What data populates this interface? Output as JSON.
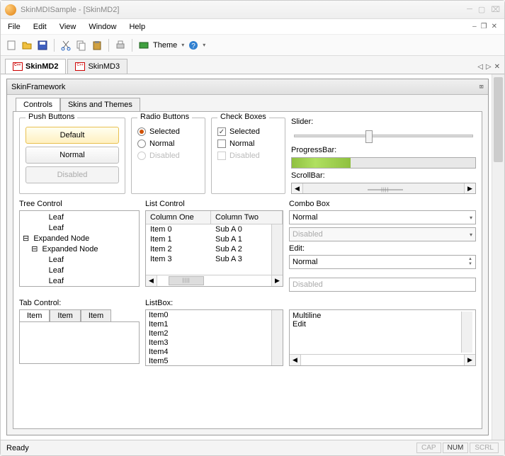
{
  "title": "SkinMDISample - [SkinMD2]",
  "menu": [
    "File",
    "Edit",
    "View",
    "Window",
    "Help"
  ],
  "toolbar": {
    "theme_label": "Theme"
  },
  "doc_tabs": [
    "SkinMD2",
    "SkinMD3"
  ],
  "child": {
    "title": "SkinFramework",
    "tabs": [
      "Controls",
      "Skins and Themes"
    ]
  },
  "groups": {
    "push": {
      "legend": "Push Buttons",
      "default": "Default",
      "normal": "Normal",
      "disabled": "Disabled"
    },
    "radio": {
      "legend": "Radio Buttons",
      "selected": "Selected",
      "normal": "Normal",
      "disabled": "Disabled"
    },
    "check": {
      "legend": "Check Boxes",
      "selected": "Selected",
      "normal": "Normal",
      "disabled": "Disabled"
    }
  },
  "slider_label": "Slider:",
  "progress_label": "ProgressBar:",
  "scrollbar_label": "ScrollBar:",
  "tree": {
    "label": "Tree Control",
    "lines": [
      "            Leaf",
      "            Leaf",
      "⊟  Expanded Node",
      "    ⊟  Expanded Node",
      "            Leaf",
      "            Leaf",
      "            Leaf"
    ]
  },
  "list": {
    "label": "List Control",
    "cols": [
      "Column One",
      "Column Two"
    ],
    "rows": [
      [
        "Item 0",
        "Sub A 0"
      ],
      [
        "Item 1",
        "Sub A 1"
      ],
      [
        "Item 2",
        "Sub A 2"
      ],
      [
        "Item 3",
        "Sub A 3"
      ]
    ]
  },
  "combo": {
    "label": "Combo Box",
    "normal": "Normal",
    "disabled": "Disabled"
  },
  "edit": {
    "label": "Edit:",
    "normal": "Normal",
    "disabled": "Disabled"
  },
  "tab": {
    "label": "Tab Control:",
    "tabs": [
      "Item",
      "Item",
      "Item"
    ]
  },
  "listbox": {
    "label": "ListBox:",
    "items": [
      "Item0",
      "Item1",
      "Item2",
      "Item3",
      "Item4",
      "Item5"
    ]
  },
  "multi": {
    "line1": "Multiline",
    "line2": "Edit"
  },
  "status": {
    "ready": "Ready",
    "cap": "CAP",
    "num": "NUM",
    "scrl": "SCRL"
  }
}
